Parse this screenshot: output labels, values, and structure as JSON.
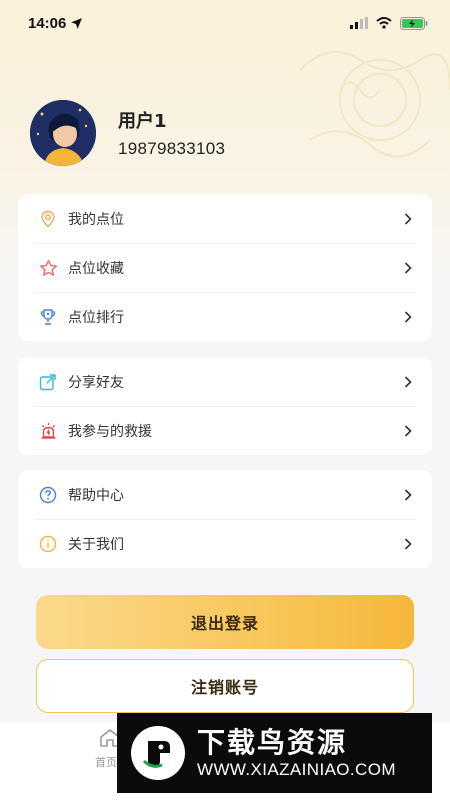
{
  "status_bar": {
    "time": "14:06"
  },
  "profile": {
    "name": "用户1",
    "phone": "19879833103"
  },
  "menu_groups": [
    {
      "items": [
        {
          "label": "我的点位",
          "icon": "location-pin-icon"
        },
        {
          "label": "点位收藏",
          "icon": "star-icon"
        },
        {
          "label": "点位排行",
          "icon": "trophy-icon"
        }
      ]
    },
    {
      "items": [
        {
          "label": "分享好友",
          "icon": "share-icon"
        },
        {
          "label": "我参与的救援",
          "icon": "alarm-siren-icon"
        }
      ]
    },
    {
      "items": [
        {
          "label": "帮助中心",
          "icon": "help-circle-icon"
        },
        {
          "label": "关于我们",
          "icon": "info-circle-icon"
        }
      ]
    }
  ],
  "buttons": {
    "logout": "退出登录",
    "cancel_account": "注销账号"
  },
  "tabbar": {
    "home_label": "首页"
  },
  "watermark": {
    "title": "下载鸟资源",
    "url": "WWW.XIAZAINIAO.COM"
  },
  "colors": {
    "accent": "#f8c65a",
    "accent_border": "#f3c45a",
    "background": "#f6f6f8"
  }
}
